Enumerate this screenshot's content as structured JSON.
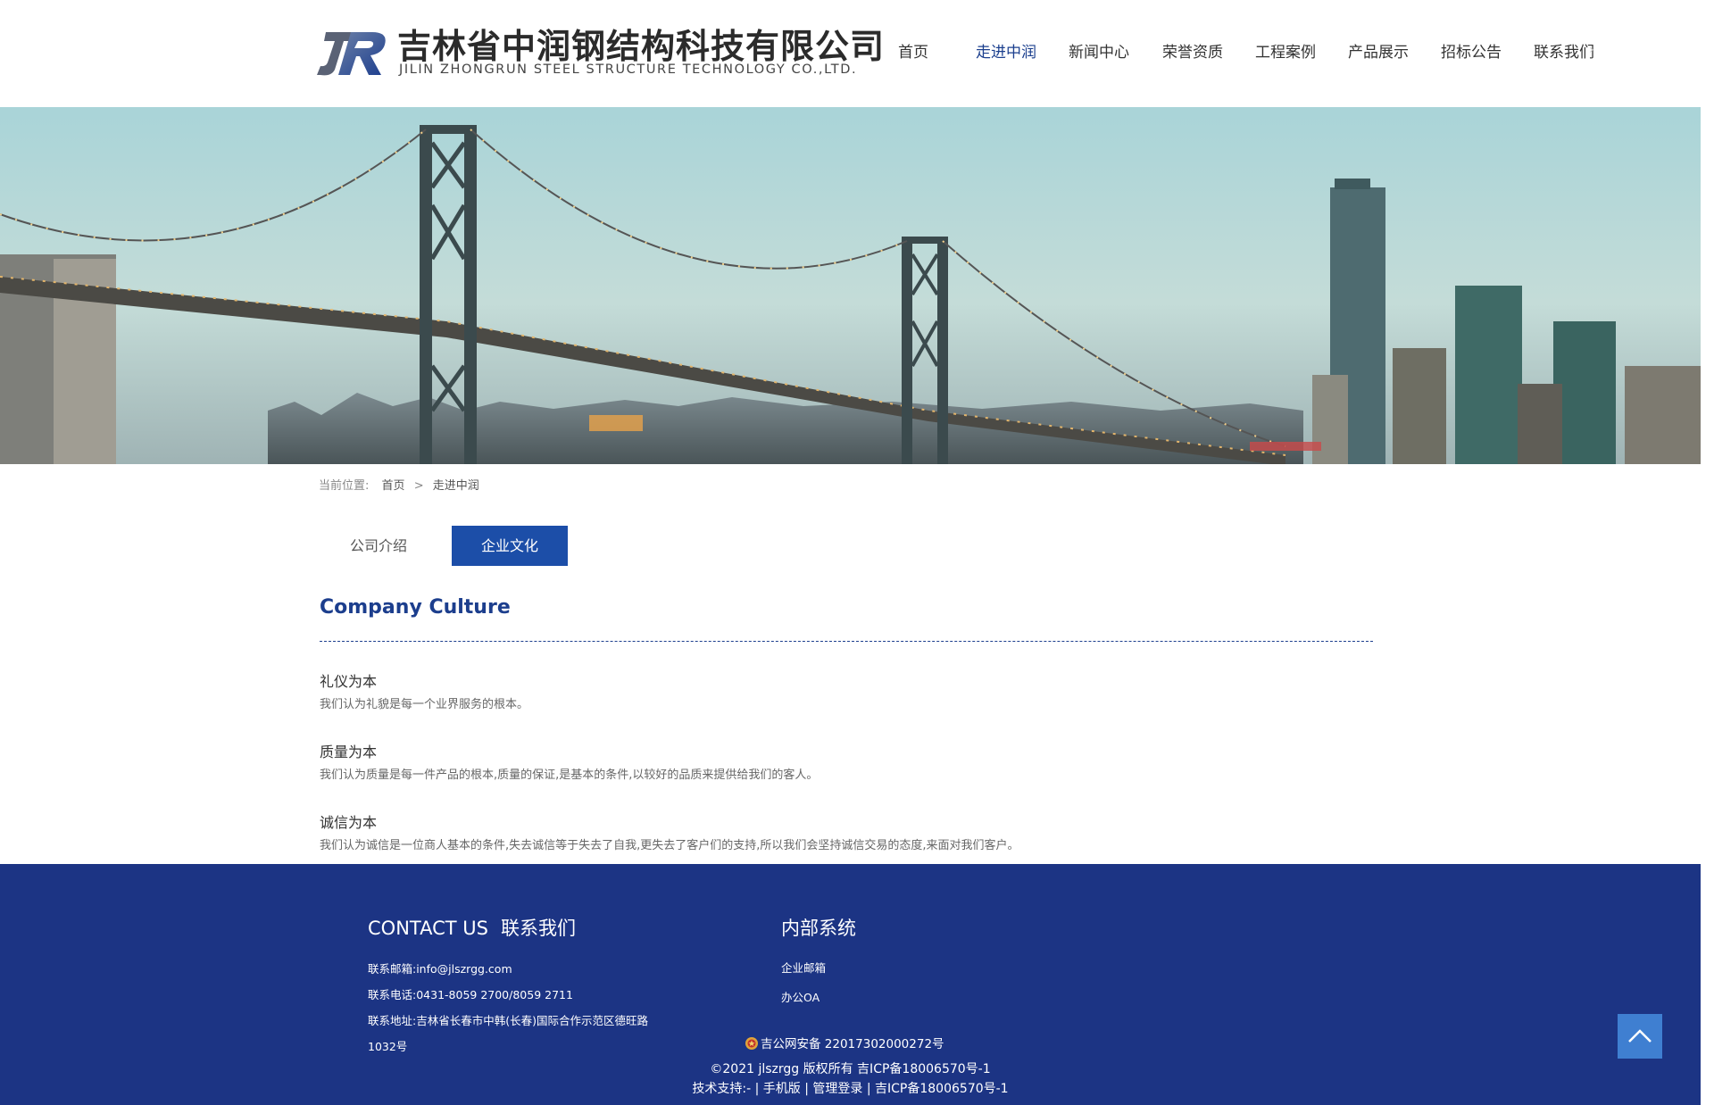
{
  "header": {
    "logo_cn": "吉林省中润钢结构科技有限公司",
    "logo_en": "JILIN ZHONGRUN STEEL STRUCTURE TECHNOLOGY CO.,LTD.",
    "nav": [
      "首页",
      "走进中润",
      "新闻中心",
      "荣誉资质",
      "工程案例",
      "产品展示",
      "招标公告",
      "联系我们"
    ],
    "active_nav": "走进中润"
  },
  "breadcrumb": {
    "label": "当前位置:",
    "home": "首页",
    "separator": ">",
    "current": "走进中润"
  },
  "tabs": {
    "intro": "公司介绍",
    "culture": "企业文化",
    "active": "企业文化"
  },
  "content": {
    "title": "Company Culture",
    "values": [
      {
        "title": "礼仪为本",
        "desc": "我们认为礼貌是每一个业界服务的根本。"
      },
      {
        "title": "质量为本",
        "desc": "我们认为质量是每一件产品的根本,质量的保证,是基本的条件,以较好的品质来提供给我们的客人。"
      },
      {
        "title": "诚信为本",
        "desc": "我们认为诚信是一位商人基本的条件,失去诚信等于失去了自我,更失去了客户们的支持,所以我们会坚持诚信交易的态度,来面对我们客户。"
      }
    ]
  },
  "footer": {
    "contact_title_en": "CONTACT US",
    "contact_title_cn": "联系我们",
    "email": "联系邮箱:info@jlszrgg.com",
    "phone": "联系电话:0431-8059 2700/8059 2711",
    "address_line1": "联系地址:吉林省长春市中韩(长春)国际合作示范区德旺路",
    "address_line2": "1032号",
    "internal_title": "内部系统",
    "internal_links": [
      "企业邮箱",
      "办公OA"
    ],
    "beian": "吉公网安备 22017302000272号",
    "copyright": "©2021 jlszrgg 版权所有 吉ICP备18006570号-1",
    "tech_support": "技术支持:- | 手机版 | 管理登录 | 吉ICP备18006570号-1"
  },
  "colors": {
    "brand_blue": "#1c3484",
    "accent_blue": "#1c4ea8",
    "title_blue": "#1c3e8d",
    "back_to_top": "#3f7fd1"
  },
  "icons": {
    "logo": "jr-logo-mark",
    "nav_more": "chevron-right-icon",
    "beian": "police-badge-icon",
    "back_to_top": "chevron-up-icon"
  }
}
